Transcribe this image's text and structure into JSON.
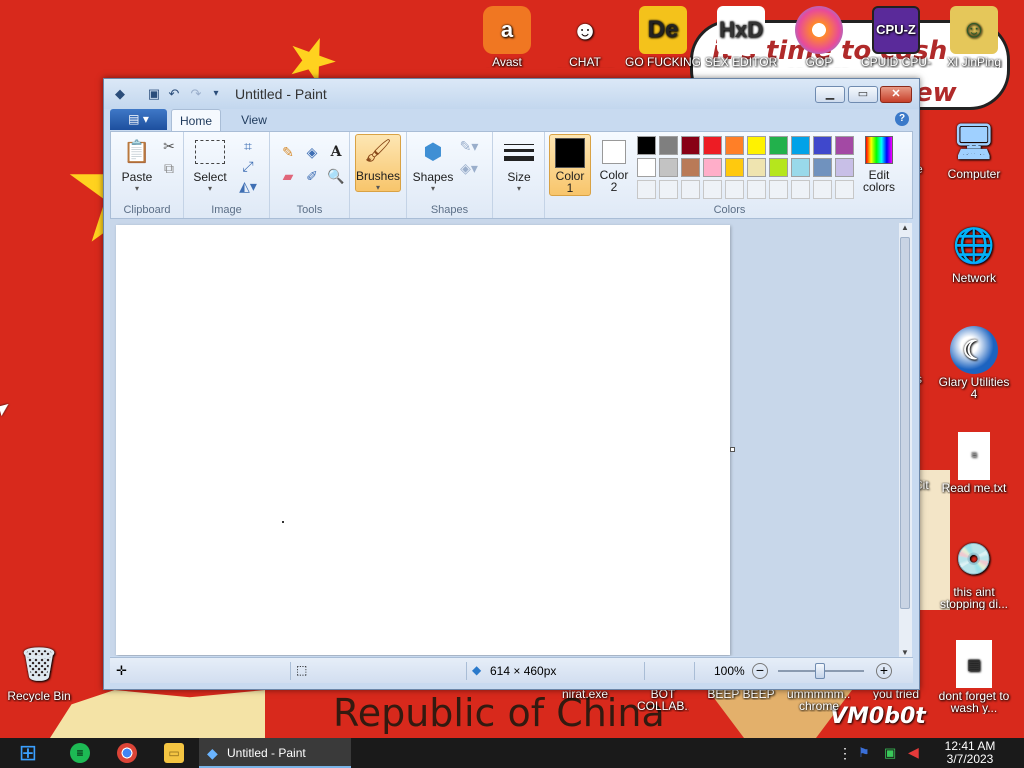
{
  "desktop": {
    "background_color": "#d8291c",
    "slogan_line1": "it's time to cash",
    "slogan_line2": "ew",
    "banner_text": "Republic of China",
    "watermark": "VM0b0t",
    "top_icons": [
      {
        "label": "Avast Antivirus",
        "icon": "avast-icon",
        "color": "#f07722"
      },
      {
        "label": "CHAT SUPPORT",
        "icon": "doctor-icon",
        "color": "#d8291c"
      },
      {
        "label": "GO FUCKING DIE WHORE",
        "icon": "de-icon",
        "color": "#f4c21b"
      },
      {
        "label": "SEX EDITOR",
        "icon": "hxd-icon",
        "color": "#ffffff"
      },
      {
        "label": "GOP BROWSER",
        "icon": "browser-icon",
        "color": "#ff8a2a"
      },
      {
        "label": "CPUID CPU-Z",
        "icon": "cpuz-icon",
        "color": "#5a2a9a"
      },
      {
        "label": "XI JinPing",
        "icon": "xi-icon",
        "color": "#e5c75a"
      }
    ],
    "right_icons": [
      {
        "label": "Computer",
        "icon": "computer-icon"
      },
      {
        "label": "Network",
        "icon": "network-icon"
      },
      {
        "label": "Glary Utilities 4",
        "icon": "glary-icon"
      },
      {
        "label": "Read me.txt",
        "icon": "text-file-icon"
      },
      {
        "label": "this aint stopping di...",
        "icon": "installer-icon"
      },
      {
        "label": "dont forget to wash y...",
        "icon": "calendar-icon"
      }
    ],
    "bottom_icons": [
      {
        "label": "Recycle Bin",
        "icon": "recycle-bin-icon"
      },
      {
        "label": "nirat.exe",
        "icon": "exe-icon"
      },
      {
        "label": "BOT COLLAB...",
        "icon": "collab-icon"
      },
      {
        "label": "BEEP BEEP",
        "icon": "beep-icon"
      },
      {
        "label": "ummmmm... chrome",
        "icon": "chrome-file-icon"
      },
      {
        "label": "you tried",
        "icon": "tried-icon"
      }
    ],
    "partial_labels": [
      "e",
      "s",
      "Cit"
    ]
  },
  "paint": {
    "title": "Untitled - Paint",
    "tabs": [
      {
        "label": "Home",
        "active": true
      },
      {
        "label": "View",
        "active": false
      }
    ],
    "help": "?",
    "groups": {
      "clipboard": {
        "label": "Clipboard",
        "paste": "Paste"
      },
      "image": {
        "label": "Image",
        "select": "Select"
      },
      "tools": {
        "label": "Tools"
      },
      "brushes": {
        "label": "Brushes"
      },
      "shapes": {
        "label": "Shapes",
        "shapes": "Shapes"
      },
      "size": {
        "label": "Size"
      },
      "colors": {
        "label": "Colors",
        "color1_line1": "Color",
        "color1_line2": "1",
        "color2_line1": "Color",
        "color2_line2": "2",
        "edit_line1": "Edit",
        "edit_line2": "colors",
        "color1": "#000000",
        "color2": "#ffffff",
        "palette_row1": [
          "#000000",
          "#7f7f7f",
          "#880015",
          "#ed1c24",
          "#ff7f27",
          "#fff200",
          "#22b14c",
          "#00a2e8",
          "#3f48cc",
          "#a349a4"
        ],
        "palette_row2": [
          "#ffffff",
          "#c3c3c3",
          "#b97a57",
          "#ffaec9",
          "#ffc90e",
          "#efe4b0",
          "#b5e61d",
          "#99d9ea",
          "#7092be",
          "#c8bfe7"
        ]
      }
    },
    "status": {
      "dimensions": "614 × 460px",
      "zoom": "100%"
    }
  },
  "taskbar": {
    "paint_label": "Untitled - Paint",
    "time": "12:41 AM",
    "date": "3/7/2023"
  }
}
